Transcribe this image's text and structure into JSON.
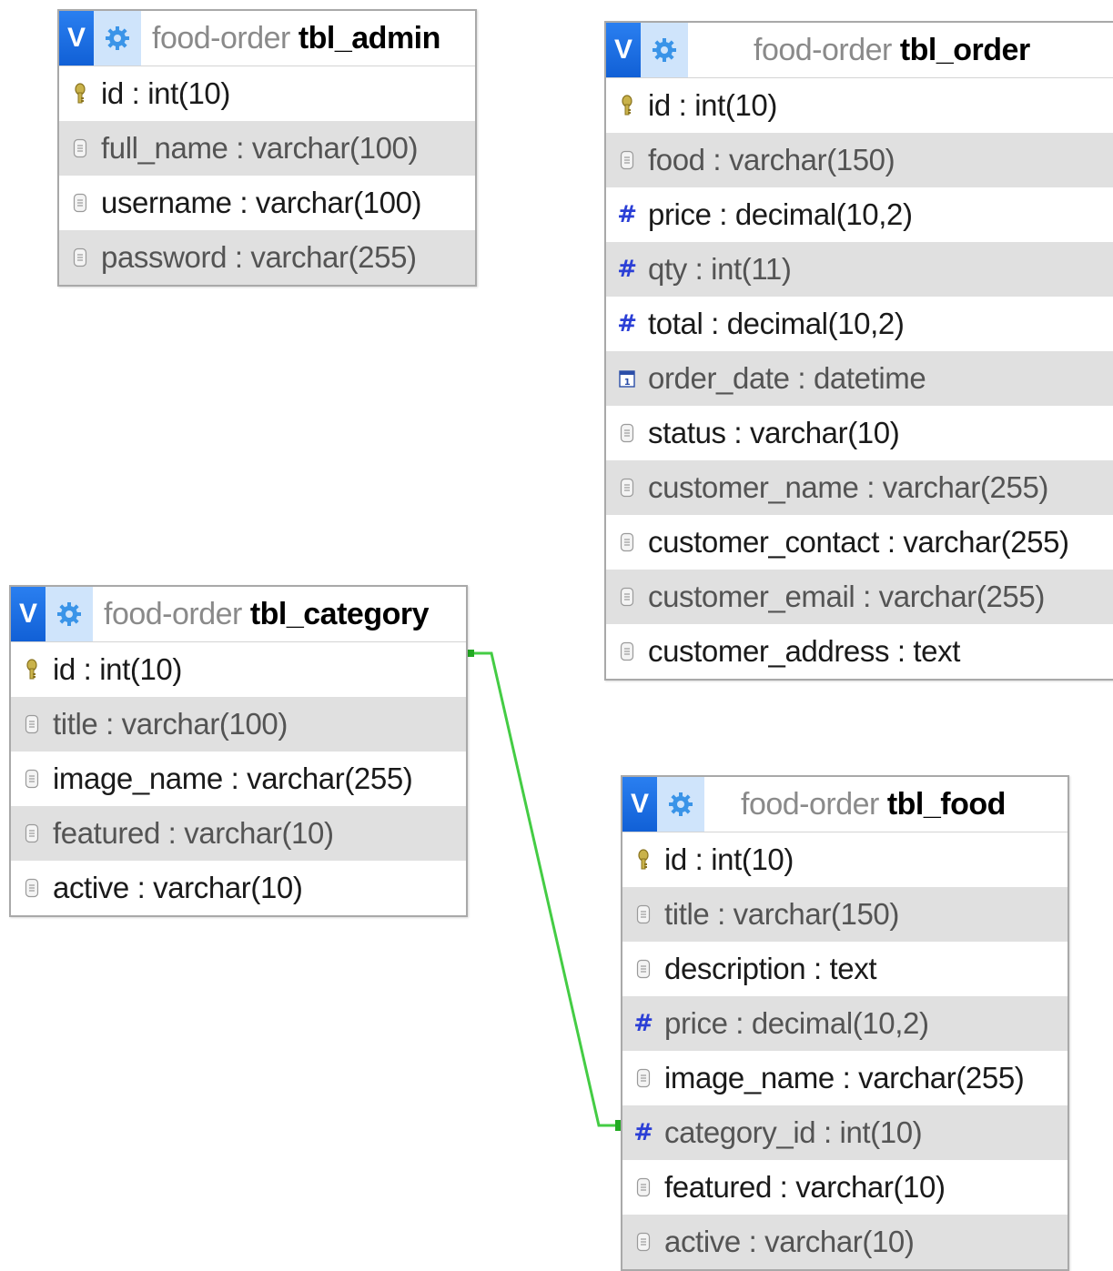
{
  "colors": {
    "header_v": "#1a6fe6",
    "header_gear_bg": "#cfe4fb",
    "relation_line": "#44cc44",
    "row_alt": "#e0e0e0",
    "numeric_icon": "#2b3fd6"
  },
  "tables": {
    "admin": {
      "badge": "V",
      "db": "food-order",
      "name": "tbl_admin",
      "columns": [
        {
          "name": "id",
          "type": "int(10)",
          "icon": "key-icon"
        },
        {
          "name": "full_name",
          "type": "varchar(100)",
          "icon": "text-column-icon"
        },
        {
          "name": "username",
          "type": "varchar(100)",
          "icon": "text-column-icon"
        },
        {
          "name": "password",
          "type": "varchar(255)",
          "icon": "text-column-icon"
        }
      ]
    },
    "order": {
      "badge": "V",
      "db": "food-order",
      "name": "tbl_order",
      "columns": [
        {
          "name": "id",
          "type": "int(10)",
          "icon": "key-icon"
        },
        {
          "name": "food",
          "type": "varchar(150)",
          "icon": "text-column-icon"
        },
        {
          "name": "price",
          "type": "decimal(10,2)",
          "icon": "numeric-column-icon"
        },
        {
          "name": "qty",
          "type": "int(11)",
          "icon": "numeric-column-icon"
        },
        {
          "name": "total",
          "type": "decimal(10,2)",
          "icon": "numeric-column-icon"
        },
        {
          "name": "order_date",
          "type": "datetime",
          "icon": "datetime-column-icon"
        },
        {
          "name": "status",
          "type": "varchar(10)",
          "icon": "text-column-icon"
        },
        {
          "name": "customer_name",
          "type": "varchar(255)",
          "icon": "text-column-icon"
        },
        {
          "name": "customer_contact",
          "type": "varchar(255)",
          "icon": "text-column-icon"
        },
        {
          "name": "customer_email",
          "type": "varchar(255)",
          "icon": "text-column-icon"
        },
        {
          "name": "customer_address",
          "type": "text",
          "icon": "text-column-icon"
        }
      ]
    },
    "category": {
      "badge": "V",
      "db": "food-order",
      "name": "tbl_category",
      "columns": [
        {
          "name": "id",
          "type": "int(10)",
          "icon": "key-icon"
        },
        {
          "name": "title",
          "type": "varchar(100)",
          "icon": "text-column-icon"
        },
        {
          "name": "image_name",
          "type": "varchar(255)",
          "icon": "text-column-icon"
        },
        {
          "name": "featured",
          "type": "varchar(10)",
          "icon": "text-column-icon"
        },
        {
          "name": "active",
          "type": "varchar(10)",
          "icon": "text-column-icon"
        }
      ]
    },
    "food": {
      "badge": "V",
      "db": "food-order",
      "name": "tbl_food",
      "columns": [
        {
          "name": "id",
          "type": "int(10)",
          "icon": "key-icon"
        },
        {
          "name": "title",
          "type": "varchar(150)",
          "icon": "text-column-icon"
        },
        {
          "name": "description",
          "type": "text",
          "icon": "text-column-icon"
        },
        {
          "name": "price",
          "type": "decimal(10,2)",
          "icon": "numeric-column-icon"
        },
        {
          "name": "image_name",
          "type": "varchar(255)",
          "icon": "text-column-icon"
        },
        {
          "name": "category_id",
          "type": "int(10)",
          "icon": "numeric-column-icon"
        },
        {
          "name": "featured",
          "type": "varchar(10)",
          "icon": "text-column-icon"
        },
        {
          "name": "active",
          "type": "varchar(10)",
          "icon": "text-column-icon"
        }
      ]
    }
  },
  "relations": [
    {
      "from_table": "tbl_category",
      "from_column": "id",
      "to_table": "tbl_food",
      "to_column": "category_id"
    }
  ]
}
